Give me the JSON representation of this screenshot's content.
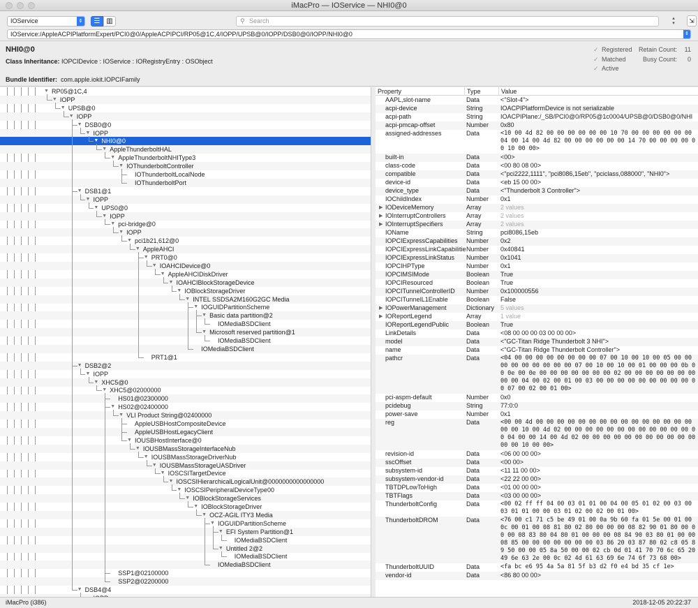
{
  "window": {
    "title": "iMacPro — IOService — NHI0@0"
  },
  "toolbar": {
    "plane": "IOService",
    "search_placeholder": "Search",
    "path": "IOService:/AppleACPIPlatformExpert/PCI0@0/AppleACPIPCI/RP05@1C,4/IOPP/UPSB@0/IOPP/DSB0@0/IOPP/NHI0@0"
  },
  "info": {
    "name": "NHI0@0",
    "class_label": "Class Inheritance:",
    "class_value": "IOPCIDevice : IOService : IORegistryEntry : OSObject",
    "bundle_label": "Bundle Identifier:",
    "bundle_value": "com.apple.iokit.IOPCIFamily",
    "registered": "Registered",
    "matched": "Matched",
    "active": "Active",
    "retain_label": "Retain Count:",
    "retain_value": "11",
    "busy_label": "Busy Count:",
    "busy_value": "0"
  },
  "tree": [
    {
      "t": "RP05@1C,4",
      "d": 0,
      "e": 1
    },
    {
      "t": "IOPP",
      "d": 1,
      "e": 1
    },
    {
      "t": "UPSB@0",
      "d": 2,
      "e": 1
    },
    {
      "t": "IOPP",
      "d": 3,
      "e": 1
    },
    {
      "t": "DSB0@0",
      "d": 4,
      "e": 1
    },
    {
      "t": "IOPP",
      "d": 5,
      "e": 1
    },
    {
      "t": "NHI0@0",
      "d": 6,
      "e": 1,
      "s": 1
    },
    {
      "t": "AppleThunderboltHAL",
      "d": 7,
      "e": 1
    },
    {
      "t": "AppleThunderboltNHIType3",
      "d": 8,
      "e": 1
    },
    {
      "t": "IOThunderboltController",
      "d": 9,
      "e": 1
    },
    {
      "t": "IOThunderboltLocalNode",
      "d": 10,
      "e": 0
    },
    {
      "t": "IOThunderboltPort",
      "d": 10,
      "e": 0
    },
    {
      "t": "DSB1@1",
      "d": 4,
      "e": 1
    },
    {
      "t": "IOPP",
      "d": 5,
      "e": 1
    },
    {
      "t": "UPS0@0",
      "d": 6,
      "e": 1
    },
    {
      "t": "IOPP",
      "d": 7,
      "e": 1
    },
    {
      "t": "pci-bridge@0",
      "d": 8,
      "e": 1
    },
    {
      "t": "IOPP",
      "d": 9,
      "e": 1
    },
    {
      "t": "pci1b21,612@0",
      "d": 10,
      "e": 1
    },
    {
      "t": "AppleAHCI",
      "d": 11,
      "e": 1
    },
    {
      "t": "PRT0@0",
      "d": 12,
      "e": 1
    },
    {
      "t": "IOAHCIDevice@0",
      "d": 13,
      "e": 1
    },
    {
      "t": "AppleAHCIDiskDriver",
      "d": 14,
      "e": 1
    },
    {
      "t": "IOAHCIBlockStorageDevice",
      "d": 15,
      "e": 1
    },
    {
      "t": "IOBlockStorageDriver",
      "d": 16,
      "e": 1
    },
    {
      "t": "INTEL SSDSA2M160G2GC Media",
      "d": 17,
      "e": 1
    },
    {
      "t": "IOGUIDPartitionScheme",
      "d": 18,
      "e": 1
    },
    {
      "t": "Basic data partition@2",
      "d": 19,
      "e": 1
    },
    {
      "t": "IOMediaBSDClient",
      "d": 20,
      "e": 0
    },
    {
      "t": "Microsoft reserved partition@1",
      "d": 19,
      "e": 1
    },
    {
      "t": "IOMediaBSDClient",
      "d": 20,
      "e": 0
    },
    {
      "t": "IOMediaBSDClient",
      "d": 18,
      "e": 0
    },
    {
      "t": "PRT1@1",
      "d": 12,
      "e": 0
    },
    {
      "t": "DSB2@2",
      "d": 4,
      "e": 1
    },
    {
      "t": "IOPP",
      "d": 5,
      "e": 1
    },
    {
      "t": "XHC5@0",
      "d": 6,
      "e": 1
    },
    {
      "t": "XHC5@02000000",
      "d": 7,
      "e": 1
    },
    {
      "t": "HS01@02300000",
      "d": 8,
      "e": 0
    },
    {
      "t": "HS02@02400000",
      "d": 8,
      "e": 1
    },
    {
      "t": "VLI Product String@02400000",
      "d": 9,
      "e": 1
    },
    {
      "t": "AppleUSBHostCompositeDevice",
      "d": 10,
      "e": 0
    },
    {
      "t": "AppleUSBHostLegacyClient",
      "d": 10,
      "e": 0
    },
    {
      "t": "IOUSBHostInterface@0",
      "d": 10,
      "e": 1
    },
    {
      "t": "IOUSBMassStorageInterfaceNub",
      "d": 11,
      "e": 1
    },
    {
      "t": "IOUSBMassStorageDriverNub",
      "d": 12,
      "e": 1
    },
    {
      "t": "IOUSBMassStorageUASDriver",
      "d": 13,
      "e": 1
    },
    {
      "t": "IOSCSITargetDevice",
      "d": 14,
      "e": 1
    },
    {
      "t": "IOSCSIHierarchicalLogicalUnit@0000000000000000",
      "d": 15,
      "e": 1
    },
    {
      "t": "IOSCSIPeripheralDeviceType00",
      "d": 16,
      "e": 1
    },
    {
      "t": "IOBlockStorageServices",
      "d": 17,
      "e": 1
    },
    {
      "t": "IOBlockStorageDriver",
      "d": 18,
      "e": 1
    },
    {
      "t": "OCZ-AGIL ITY3 Media",
      "d": 19,
      "e": 1
    },
    {
      "t": "IOGUIDPartitionScheme",
      "d": 20,
      "e": 1
    },
    {
      "t": "EFI System Partition@1",
      "d": 21,
      "e": 1
    },
    {
      "t": "IOMediaBSDClient",
      "d": 22,
      "e": 0
    },
    {
      "t": "Untitled 2@2",
      "d": 21,
      "e": 1
    },
    {
      "t": "IOMediaBSDClient",
      "d": 22,
      "e": 0
    },
    {
      "t": "IOMediaBSDClient",
      "d": 20,
      "e": 0
    },
    {
      "t": "SSP1@02100000",
      "d": 8,
      "e": 0
    },
    {
      "t": "SSP2@02200000",
      "d": 8,
      "e": 0
    },
    {
      "t": "DSB4@4",
      "d": 4,
      "e": 1
    },
    {
      "t": "IOPP",
      "d": 5,
      "e": 0
    }
  ],
  "props_header": {
    "property": "Property",
    "type": "Type",
    "value": "Value"
  },
  "props": [
    {
      "k": "AAPL,slot-name",
      "t": "Data",
      "v": "<\"Slot-4\">"
    },
    {
      "k": "acpi-device",
      "t": "String",
      "v": "IOACPIPlatformDevice is not serializable"
    },
    {
      "k": "acpi-path",
      "t": "String",
      "v": "IOACPIPlane:/_SB/PCI0@0/RP05@1c0004/UPSB@0/DSB0@0/NHI0@0"
    },
    {
      "k": "acpi-pmcap-offset",
      "t": "Number",
      "v": "0x80"
    },
    {
      "k": "assigned-addresses",
      "t": "Data",
      "v": "<10 00 4d 82 00 00 00 00 00 00 10 70 00 00 00 00 00 00 04 00 14 00 4d 82 00 00 00 00 00 00 14 70 00 00 00 00 00 10 00 00>",
      "m": 1,
      "n": 3
    },
    {
      "k": "built-in",
      "t": "Data",
      "v": "<00>"
    },
    {
      "k": "class-code",
      "t": "Data",
      "v": "<00 80 08 00>"
    },
    {
      "k": "compatible",
      "t": "Data",
      "v": "<\"pci2222,1111\", \"pci8086,15eb\", \"pciclass,088000\", \"NHI0\">"
    },
    {
      "k": "device-id",
      "t": "Data",
      "v": "<eb 15 00 00>"
    },
    {
      "k": "device_type",
      "t": "Data",
      "v": "<\"Thunderbolt 3 Controller\">"
    },
    {
      "k": "IOChildIndex",
      "t": "Number",
      "v": "0x1"
    },
    {
      "k": "IODeviceMemory",
      "t": "Array",
      "v": "2 values",
      "x": 1,
      "g": 1
    },
    {
      "k": "IOInterruptControllers",
      "t": "Array",
      "v": "2 values",
      "x": 1,
      "g": 1
    },
    {
      "k": "IOInterruptSpecifiers",
      "t": "Array",
      "v": "2 values",
      "x": 1,
      "g": 1
    },
    {
      "k": "IOName",
      "t": "String",
      "v": "pci8086,15eb"
    },
    {
      "k": "IOPCIExpressCapabilities",
      "t": "Number",
      "v": "0x2"
    },
    {
      "k": "IOPCIExpressLinkCapabilities",
      "t": "Number",
      "v": "0x40841"
    },
    {
      "k": "IOPCIExpressLinkStatus",
      "t": "Number",
      "v": "0x1041"
    },
    {
      "k": "IOPCIHPType",
      "t": "Number",
      "v": "0x1"
    },
    {
      "k": "IOPCIMSIMode",
      "t": "Boolean",
      "v": "True"
    },
    {
      "k": "IOPCIResourced",
      "t": "Boolean",
      "v": "True"
    },
    {
      "k": "IOPCITunnelControllerID",
      "t": "Number",
      "v": "0x100000556"
    },
    {
      "k": "IOPCITunnelL1Enable",
      "t": "Boolean",
      "v": "False"
    },
    {
      "k": "IOPowerManagement",
      "t": "Dictionary",
      "v": "5 values",
      "x": 1,
      "g": 1
    },
    {
      "k": "IOReportLegend",
      "t": "Array",
      "v": "1 value",
      "x": 1,
      "g": 1
    },
    {
      "k": "IOReportLegendPublic",
      "t": "Boolean",
      "v": "True"
    },
    {
      "k": "LinkDetails",
      "t": "Data",
      "v": "<08 00 00 00 03 00 00 00>"
    },
    {
      "k": "model",
      "t": "Data",
      "v": "<\"GC-Titan Ridge Thunderbolt 3 NHI\">"
    },
    {
      "k": "name",
      "t": "Data",
      "v": "<\"GC-Titan Ridge Thunderbolt Controller\">"
    },
    {
      "k": "pathcr",
      "t": "Data",
      "v": "<04 00 00 00 00 00 00 00 00 07 00 10 00 10 00 05 00 00 00 00 00 00 00 00 00 07 00 10 00 10 00 01 00 00 00 0b 00 0e 00 0e 00 00 00 00 00 00 00 02 00 00 00 00 00 00 00 00 00 04 00 02 00 01 00 03 00 00 00 00 00 00 00 00 00 00 07 00 02 00 01 00>",
      "m": 1,
      "n": 5
    },
    {
      "k": "pci-aspm-default",
      "t": "Number",
      "v": "0x0"
    },
    {
      "k": "pcidebug",
      "t": "String",
      "v": "77:0:0"
    },
    {
      "k": "power-save",
      "t": "Number",
      "v": "0x1"
    },
    {
      "k": "reg",
      "t": "Data",
      "v": "<00 00 4d 00 00 00 00 00 00 00 00 00 00 00 00 00 00 00 00 00 10 00 4d 02 00 00 00 00 00 00 00 00 00 00 00 00 00 04 00 00 14 00 4d 02 00 00 00 00 00 00 00 00 00 00 00 00 00 10 00 00>",
      "m": 1,
      "n": 4
    },
    {
      "k": "revision-id",
      "t": "Data",
      "v": "<06 00 00 00>"
    },
    {
      "k": "sscOffset",
      "t": "Data",
      "v": "<00 00>"
    },
    {
      "k": "subsystem-id",
      "t": "Data",
      "v": "<11 11 00 00>"
    },
    {
      "k": "subsystem-vendor-id",
      "t": "Data",
      "v": "<22 22 00 00>"
    },
    {
      "k": "TBTDPLowToHigh",
      "t": "Data",
      "v": "<01 00 00 00>"
    },
    {
      "k": "TBTFlags",
      "t": "Data",
      "v": "<03 00 00 00>"
    },
    {
      "k": "ThunderboltConfig",
      "t": "Data",
      "v": "<00 02 ff ff 04 00 03 01 01 00 04 00 05 01 02 00 03 00 03 01 01 00 00 03 01 02 00 02 00 01 00>",
      "m": 1,
      "n": 2
    },
    {
      "k": "ThunderboltDROM",
      "t": "Data",
      "v": "<76 00 c1 71 c5 be 49 01 00 0a 9b 60 fa 01 5e 00 01 00 0c 00 01 00 08 81 80 02 80 00 00 00 08 82 90 01 80 00 00 00 08 83 80 04 80 01 00 00 00 08 84 90 03 80 01 00 00 08 85 00 00 00 00 00 00 00 03 86 20 03 87 80 02 c8 05 89 50 00 00 05 8a 50 00 00 02 cb 0d 01 41 70 70 6c 65 20 49 6e 63 2e 00 0c 02 4d 61 63 69 6e 74 6f 73 68 00>",
      "m": 1,
      "n": 6
    },
    {
      "k": "ThunderboltUUID",
      "t": "Data",
      "v": "<fa bc e6 95 4a 5a 81 5f b3 d2 f0 e4 bd 35 cf 1e>",
      "m": 1
    },
    {
      "k": "vendor-id",
      "t": "Data",
      "v": "<86 80 00 00>"
    }
  ],
  "status": {
    "left": "iMacPro (i386)",
    "right": "2018-12-05 20:22:37"
  }
}
